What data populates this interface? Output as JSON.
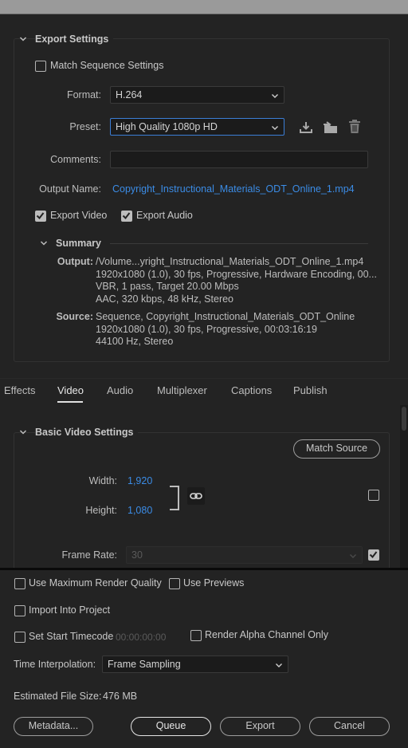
{
  "export_settings": {
    "title": "Export Settings",
    "match_sequence": {
      "label": "Match Sequence Settings",
      "checked": false
    },
    "format": {
      "label": "Format:",
      "value": "H.264"
    },
    "preset": {
      "label": "Preset:",
      "value": "High Quality 1080p HD"
    },
    "comments": {
      "label": "Comments:",
      "value": ""
    },
    "output_name": {
      "label": "Output Name:",
      "value": "Copyright_Instructional_Materials_ODT_Online_1.mp4"
    },
    "export_video": {
      "label": "Export Video",
      "checked": true
    },
    "export_audio": {
      "label": "Export Audio",
      "checked": true
    },
    "icons": [
      "save-preset-icon",
      "import-preset-icon",
      "delete-preset-icon"
    ]
  },
  "summary": {
    "title": "Summary",
    "output_label": "Output:",
    "output_lines": [
      "/Volume...yright_Instructional_Materials_ODT_Online_1.mp4",
      "1920x1080 (1.0), 30 fps, Progressive, Hardware Encoding, 00...",
      "VBR, 1 pass, Target 20.00 Mbps",
      "AAC, 320 kbps, 48 kHz, Stereo"
    ],
    "source_label": "Source:",
    "source_lines": [
      "Sequence, Copyright_Instructional_Materials_ODT_Online",
      "1920x1080 (1.0), 30 fps, Progressive, 00:03:16:19",
      "44100 Hz, Stereo"
    ]
  },
  "tabs": [
    {
      "label": "Effects",
      "active": false
    },
    {
      "label": "Video",
      "active": true
    },
    {
      "label": "Audio",
      "active": false
    },
    {
      "label": "Multiplexer",
      "active": false
    },
    {
      "label": "Captions",
      "active": false
    },
    {
      "label": "Publish",
      "active": false
    }
  ],
  "basic_video": {
    "title": "Basic Video Settings",
    "match_source": "Match Source",
    "width_label": "Width:",
    "width_value": "1,920",
    "height_label": "Height:",
    "height_value": "1,080",
    "frame_rate_label": "Frame Rate:",
    "frame_rate_value": "30"
  },
  "bottom": {
    "max_render": {
      "label": "Use Maximum Render Quality",
      "checked": false
    },
    "use_previews": {
      "label": "Use Previews",
      "checked": false
    },
    "import_project": {
      "label": "Import Into Project",
      "checked": false
    },
    "set_start_tc": {
      "label": "Set Start Timecode",
      "checked": false,
      "timecode": "00:00:00:00"
    },
    "render_alpha": {
      "label": "Render Alpha Channel Only",
      "checked": false
    },
    "time_interp": {
      "label": "Time Interpolation:",
      "value": "Frame Sampling"
    },
    "file_size": {
      "label": "Estimated File Size:",
      "value": "476 MB"
    },
    "buttons": {
      "metadata": "Metadata...",
      "queue": "Queue",
      "export": "Export",
      "cancel": "Cancel"
    }
  },
  "colors": {
    "accent": "#3b8ce6",
    "background": "#232323",
    "field": "#1b1b1b"
  }
}
